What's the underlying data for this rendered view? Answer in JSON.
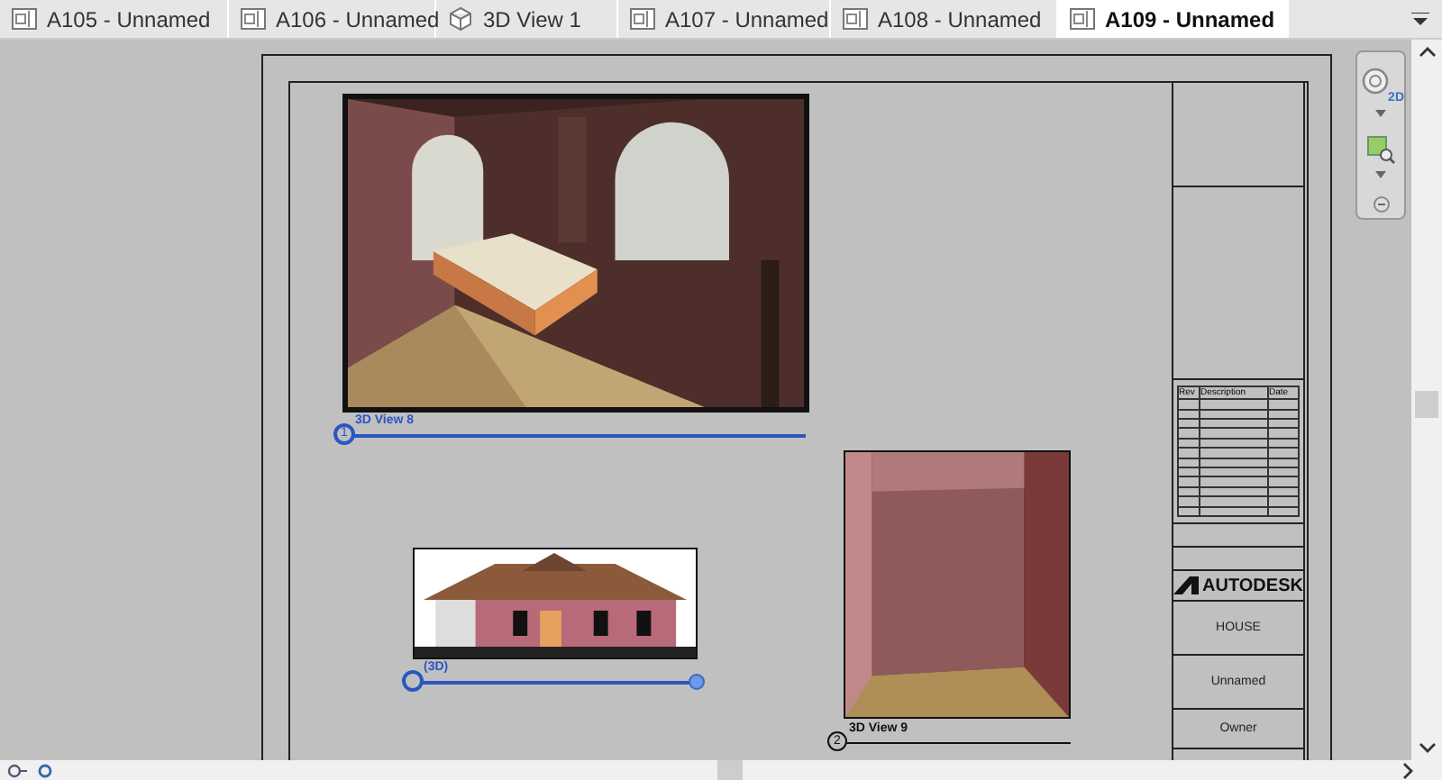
{
  "tabs": [
    {
      "label": "A105 - Unnamed",
      "kind": "sheet",
      "selected": false
    },
    {
      "label": "A106 - Unnamed",
      "kind": "sheet",
      "selected": false
    },
    {
      "label": "3D View 1",
      "kind": "model",
      "selected": false
    },
    {
      "label": "A107 - Unnamed",
      "kind": "sheet",
      "selected": false
    },
    {
      "label": "A108 - Unnamed",
      "kind": "sheet",
      "selected": false
    },
    {
      "label": "A109 - Unnamed",
      "kind": "sheet",
      "selected": true
    }
  ],
  "navigation_bar": {
    "wheel_label": "2D"
  },
  "sheet": {
    "viewports": [
      {
        "title": "3D View 8",
        "number": "1",
        "selected": true
      },
      {
        "title": "(3D)",
        "selected": true
      },
      {
        "title": "3D View 9",
        "number": "2",
        "selected": false
      }
    ],
    "title_block": {
      "revision_columns": [
        "Rev",
        "Description",
        "Date"
      ],
      "company": "AUTODESK",
      "project": "HOUSE",
      "sheet_name": "Unnamed",
      "client": "Owner"
    }
  }
}
